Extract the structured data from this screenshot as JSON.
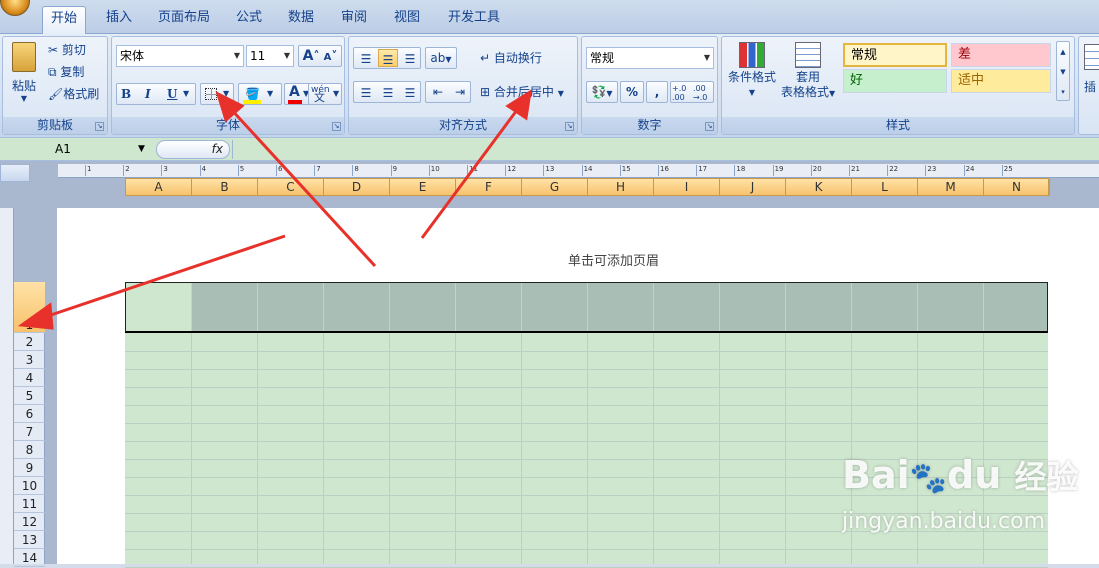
{
  "tabs": [
    "开始",
    "插入",
    "页面布局",
    "公式",
    "数据",
    "审阅",
    "视图",
    "开发工具"
  ],
  "clipboard": {
    "paste": "粘贴",
    "cut": "剪切",
    "copy": "复制",
    "format_painter": "格式刷",
    "label": "剪贴板"
  },
  "font": {
    "name": "宋体",
    "size": "11",
    "bold": "B",
    "italic": "I",
    "underline": "U",
    "grow": "A",
    "shrink": "A",
    "label": "字体",
    "phonetic": "wén"
  },
  "alignment": {
    "wrap_text": "自动换行",
    "merge_center": "合并后居中",
    "label": "对齐方式"
  },
  "number": {
    "format": "常规",
    "percent": "%",
    "comma": ",",
    "label": "数字"
  },
  "styles": {
    "conditional_format": "条件格式",
    "format_table_line1": "套用",
    "format_table_line2": "表格格式",
    "normal": "常规",
    "bad": "差",
    "good": "好",
    "neutral": "适中",
    "label": "样式"
  },
  "cells_partial": "插",
  "name_box": "A1",
  "fx": "fx",
  "columns": [
    "A",
    "B",
    "C",
    "D",
    "E",
    "F",
    "G",
    "H",
    "I",
    "J",
    "K",
    "L",
    "M",
    "N"
  ],
  "rows": [
    "1",
    "2",
    "3",
    "4",
    "5",
    "6",
    "7",
    "8",
    "9",
    "10",
    "11",
    "12",
    "13",
    "14"
  ],
  "ruler_numbers": [
    "1",
    "2",
    "3",
    "4",
    "5",
    "6",
    "7",
    "8",
    "9",
    "10",
    "11",
    "12",
    "13",
    "14",
    "15",
    "16",
    "17",
    "18",
    "19",
    "20",
    "21",
    "22",
    "23",
    "24",
    "25"
  ],
  "header_placeholder": "单击可添加页眉",
  "watermark": {
    "brand": "Bai",
    "brand_suffix": "du",
    "cn": "经验",
    "url": "jingyan.baidu.com"
  },
  "colors": {
    "grid_bg": "#cfe6cf",
    "row1_bg": "#a9bfb6",
    "header_orange": "#f7c26d",
    "arrow": "#e8312a"
  }
}
